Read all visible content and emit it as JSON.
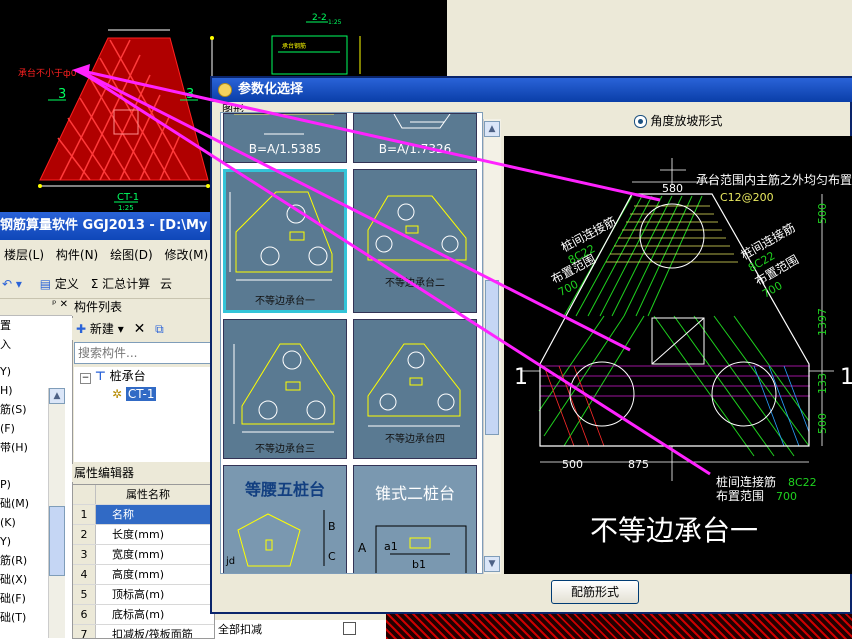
{
  "cad_top": {
    "dim_title": "2-2",
    "dim_scale": "1:25",
    "note_red": "承台不小于ф0",
    "dim_3a": "3",
    "dim_3b": "3",
    "ct_label": "CT-1",
    "ct_scale": "1:25",
    "green_label": "承台钢筋"
  },
  "main_window": {
    "title": "钢筋算量软件 GGJ2013 - [D:\\My",
    "menu": [
      "楼层(L)",
      "构件(N)",
      "绘图(D)",
      "修改(M)"
    ],
    "toolbar": {
      "define": "定义",
      "sum": "Σ 汇总计算",
      "extra": "云"
    },
    "left_panel_items": [
      "置",
      "入",
      "Y)",
      "H)",
      "筋(S)",
      "(F)",
      "带(H)",
      "P)",
      "础(M)",
      "(K)",
      "Y)",
      "筋(R)",
      "础(X)",
      "础(F)",
      "础(T)"
    ],
    "component_list": {
      "header": "构件列表",
      "new_button": "新建",
      "search_placeholder": "搜索构件...",
      "tree_root": "桩承台",
      "tree_child": "CT-1"
    },
    "property_editor": {
      "header": "属性编辑器",
      "col_name": "属性名称",
      "rows": [
        {
          "no": "1",
          "name": "名称"
        },
        {
          "no": "2",
          "name": "长度(mm)"
        },
        {
          "no": "3",
          "name": "宽度(mm)"
        },
        {
          "no": "4",
          "name": "高度(mm)"
        },
        {
          "no": "5",
          "name": "顶标高(m)"
        },
        {
          "no": "6",
          "name": "底标高(m)"
        },
        {
          "no": "7",
          "name": "扣减板/筏板面筋"
        }
      ],
      "bottom_value": "全部扣减"
    }
  },
  "dialog": {
    "title": "参数化选择",
    "gallery_label": "图形",
    "thumbs": [
      {
        "label": "B=A/1.5385"
      },
      {
        "label": "B=A/1.7326"
      },
      {
        "label": "不等边承台一"
      },
      {
        "label": "不等边承台二"
      },
      {
        "label": "不等边承台三"
      },
      {
        "label": "不等边承台四"
      },
      {
        "label": "等腰五桩台"
      },
      {
        "label": "锥式二桩台"
      }
    ],
    "radio_label": "角度放坡形式",
    "config_button": "配筋形式",
    "preview": {
      "top_note": "承台范围内主筋之外均匀布置",
      "dim_580": "580",
      "rebar_top": "C12@200",
      "left_tie": "桩间连接筋",
      "left_tie_spec": "8C22",
      "left_range": "布置范围",
      "left_range_val": "700",
      "right_tie": "桩间连接筋",
      "right_tie_spec": "8C22",
      "right_range": "布置范围",
      "right_range_val": "700",
      "dim_500a": "500",
      "dim_1397": "1397",
      "dim_133": "133",
      "dim_500b": "500",
      "dim_500c": "500",
      "dim_875": "875",
      "num_left": "1",
      "num_right": "1",
      "bottom_tie": "桩间连接筋",
      "bottom_tie_spec": "8C22",
      "bottom_range": "布置范围",
      "bottom_range_val": "700",
      "caption": "不等边承台一"
    }
  }
}
